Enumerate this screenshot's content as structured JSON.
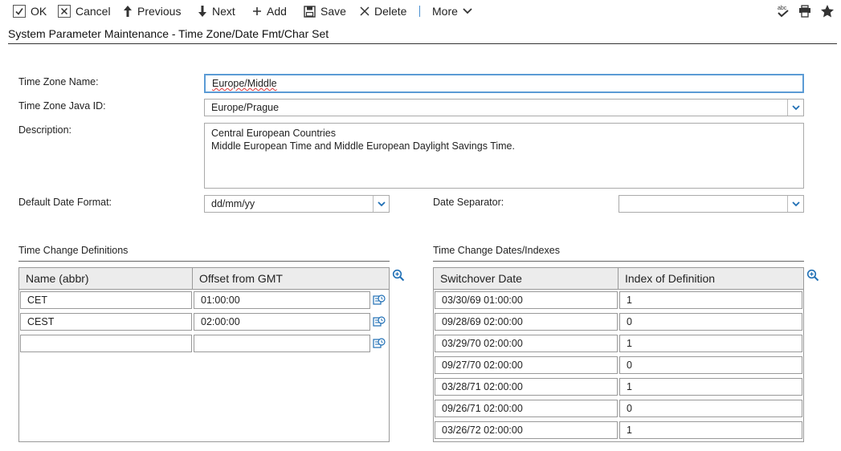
{
  "toolbar": {
    "ok": "OK",
    "cancel": "Cancel",
    "previous": "Previous",
    "next": "Next",
    "add": "Add",
    "save": "Save",
    "delete": "Delete",
    "more": "More"
  },
  "page_title": "System Parameter Maintenance - Time Zone/Date Fmt/Char Set",
  "form": {
    "time_zone_name_label": "Time Zone Name:",
    "time_zone_name_value": "Europe/Middle",
    "java_id_label": "Time Zone Java ID:",
    "java_id_value": "Europe/Prague",
    "description_label": "Description:",
    "description_line1": "Central European Countries",
    "description_line2": "Middle European Time and Middle European Daylight Savings Time.",
    "date_format_label": "Default Date Format:",
    "date_format_value": "dd/mm/yy",
    "date_separator_label": "Date Separator:",
    "date_separator_value": ""
  },
  "definitions": {
    "section_label": "Time Change Definitions",
    "col_name": "Name (abbr)",
    "col_offset": "Offset from GMT",
    "rows": [
      {
        "name": "CET",
        "offset": "01:00:00"
      },
      {
        "name": "CEST",
        "offset": "02:00:00"
      },
      {
        "name": "",
        "offset": ""
      }
    ]
  },
  "dates": {
    "section_label": "Time Change Dates/Indexes",
    "col_date": "Switchover Date",
    "col_index": "Index of Definition",
    "rows": [
      {
        "date": "03/30/69 01:00:00",
        "index": "1"
      },
      {
        "date": "09/28/69 02:00:00",
        "index": "0"
      },
      {
        "date": "03/29/70 02:00:00",
        "index": "1"
      },
      {
        "date": "09/27/70 02:00:00",
        "index": "0"
      },
      {
        "date": "03/28/71 02:00:00",
        "index": "1"
      },
      {
        "date": "09/26/71 02:00:00",
        "index": "0"
      },
      {
        "date": "03/26/72 02:00:00",
        "index": "1"
      }
    ]
  },
  "colors": {
    "accent": "#1f6fb5",
    "focus_border": "#5b9bd5",
    "header_bg": "#ececec"
  }
}
